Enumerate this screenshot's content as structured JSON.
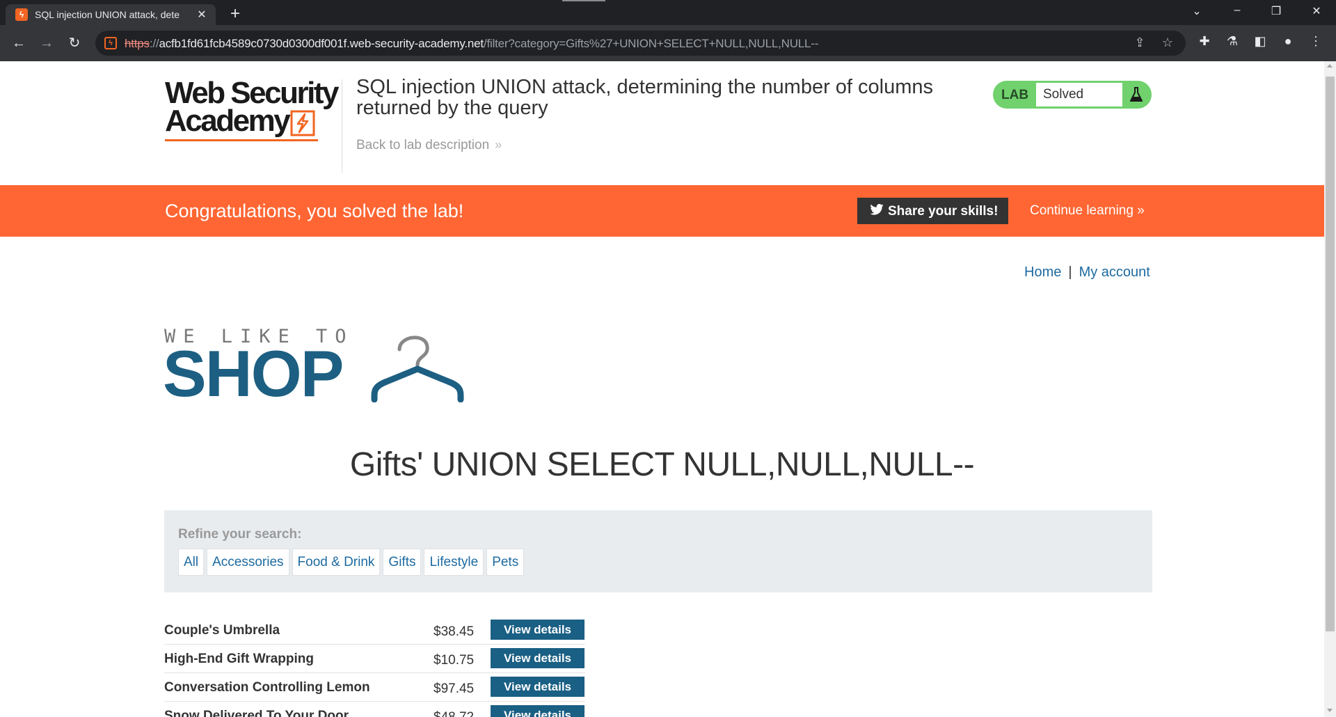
{
  "browser": {
    "tab_title": "SQL injection UNION attack, dete",
    "url_scheme": "https",
    "url_sep": "://",
    "url_host": "acfb1fd61fcb4589c0730d0300df001f.web-security-academy.net",
    "url_rest": "/filter?category=Gifts%27+UNION+SELECT+NULL,NULL,NULL--"
  },
  "academy": {
    "logo_line1": "Web Security",
    "logo_line2": "Academy",
    "lab_title": "SQL injection UNION attack, determining the number of columns returned by the query",
    "back_link": "Back to lab description",
    "status_label": "LAB",
    "status_value": "Solved",
    "accent_color": "#f26522",
    "solved_color": "#70d16d"
  },
  "banner": {
    "message": "Congratulations, you solved the lab!",
    "share_label": "Share your skills!",
    "continue_label": "Continue learning",
    "color": "#ff6633"
  },
  "nav": {
    "home": "Home",
    "separator": "|",
    "account": "My account"
  },
  "shop": {
    "tagline": "WE LIKE TO",
    "word": "SHOP",
    "brand_color": "#1d5f82"
  },
  "category_heading": "Gifts' UNION SELECT NULL,NULL,NULL--",
  "refine": {
    "label": "Refine your search:",
    "filters": [
      "All",
      "Accessories",
      "Food & Drink",
      "Gifts",
      "Lifestyle",
      "Pets"
    ]
  },
  "products": [
    {
      "name": "Couple's Umbrella",
      "price": "$38.45",
      "button": "View details"
    },
    {
      "name": "High-End Gift Wrapping",
      "price": "$10.75",
      "button": "View details"
    },
    {
      "name": "Conversation Controlling Lemon",
      "price": "$97.45",
      "button": "View details"
    },
    {
      "name": "Snow Delivered To Your Door",
      "price": "$48.72",
      "button": "View details"
    }
  ]
}
